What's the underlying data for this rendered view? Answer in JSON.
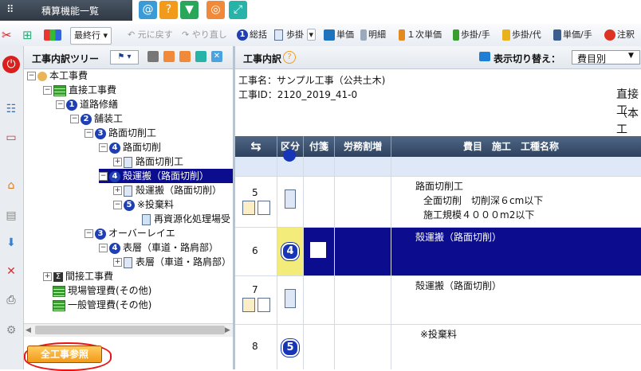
{
  "app": {
    "title": "積算機能一覧"
  },
  "toolbar": {
    "dropdown_value": "最終行",
    "undo_label": "元に戻す",
    "redo_label": "やり直し",
    "items": [
      "総括",
      "歩掛",
      "単価",
      "明細",
      "１次単価",
      "歩掛/手",
      "歩掛/代",
      "単価/手",
      "注釈"
    ]
  },
  "tree_panel": {
    "title": "工事内訳ツリー",
    "nodes": [
      {
        "label": "本工事費",
        "num": ""
      },
      {
        "label": "直接工事費",
        "num": ""
      },
      {
        "label": "道路修繕",
        "num": "1"
      },
      {
        "label": "舗装工",
        "num": "2"
      },
      {
        "label": "路面切削工",
        "num": "3"
      },
      {
        "label": "路面切削",
        "num": "4"
      },
      {
        "label": "路面切削工",
        "num": ""
      },
      {
        "label": "殻運搬（路面切削）",
        "num": "4"
      },
      {
        "label": "殻運搬（路面切削）",
        "num": ""
      },
      {
        "label": "※投棄料",
        "num": "5"
      },
      {
        "label": "再資源化処理場受",
        "num": ""
      },
      {
        "label": "オーバーレイエ",
        "num": "3"
      },
      {
        "label": "表層（車道・路肩部）",
        "num": "4"
      },
      {
        "label": "表層（車道・路肩部）",
        "num": ""
      },
      {
        "label": "間接工事費",
        "num": ""
      },
      {
        "label": "現場管理費(その他)",
        "num": ""
      },
      {
        "label": "一般管理費(その他)",
        "num": ""
      }
    ],
    "all_ref_button": "全工事参照"
  },
  "detail_panel": {
    "title": "工事内訳",
    "view_switch_label": "表示切り替え：",
    "view_switch_value": "費目別",
    "project_name": "工事名：サンプル工事（公共土木)",
    "project_id": "工事ID：2120_2019_41-0",
    "heading_partial_1": "直接工",
    "heading_partial_2": "（本工",
    "columns": [
      "区分",
      "付箋",
      "労務割増",
      "費目　施工　工種名称"
    ],
    "rows": [
      {
        "no": "5",
        "num": "",
        "lines": [
          "路面切削工",
          "全面切削　切削深６cm以下",
          "施工規模４０００m2以下"
        ]
      },
      {
        "no": "6",
        "num": "4",
        "lines": [
          "殻運搬（路面切削）"
        ]
      },
      {
        "no": "7",
        "num": "",
        "lines": [
          "殻運搬（路面切削）"
        ]
      },
      {
        "no": "8",
        "num": "5",
        "lines": [
          "※投棄料"
        ]
      }
    ]
  },
  "colors": {
    "selected": "#0b0d8e",
    "accent_orange": "#f29a1b"
  }
}
